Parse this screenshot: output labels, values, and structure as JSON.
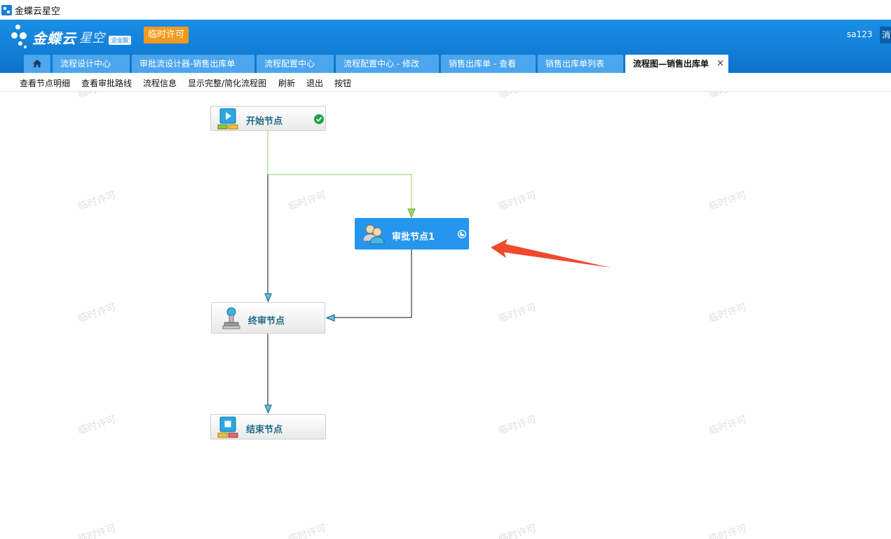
{
  "window": {
    "title": "金蝶云星空"
  },
  "header": {
    "brand": "金蝶云",
    "product": "星空",
    "edition": "企业版",
    "license_badge": "临时许可",
    "user": "sa123",
    "message_button": "消"
  },
  "tabs": [
    {
      "label": "流程设计中心",
      "active": false
    },
    {
      "label": "审批流设计器-销售出库单",
      "active": false
    },
    {
      "label": "流程配置中心",
      "active": false
    },
    {
      "label": "流程配置中心 - 修改",
      "active": false
    },
    {
      "label": "销售出库单 - 查看",
      "active": false
    },
    {
      "label": "销售出库单列表",
      "active": false
    },
    {
      "label": "流程图—销售出库单",
      "active": true,
      "close": "×"
    }
  ],
  "toolbar": {
    "items": [
      "查看节点明细",
      "查看审批路线",
      "流程信息",
      "显示完整/简化流程图",
      "刷新",
      "退出",
      "按钮"
    ]
  },
  "watermark": "临时许可",
  "flow": {
    "nodes": {
      "start": {
        "label": "开始节点",
        "status": "completed",
        "icon": "play-icon"
      },
      "approval": {
        "label": "审批节点1",
        "status": "in-progress",
        "icon": "users-icon"
      },
      "final": {
        "label": "终审节点",
        "icon": "stamp-icon"
      },
      "end": {
        "label": "结束节点",
        "icon": "stop-icon"
      }
    },
    "colors": {
      "completed_line": "#8fd15a",
      "line": "#111111",
      "arrow_fill": "#5bc8ef",
      "selected_node": "#2596ee",
      "annotation_arrow": "#f04a2e",
      "check": "#1aa34a"
    }
  }
}
